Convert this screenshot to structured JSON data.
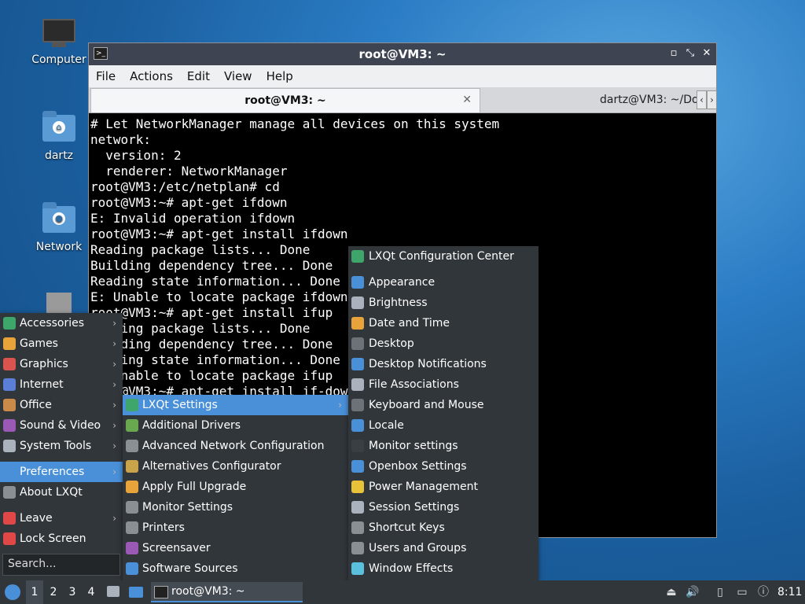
{
  "desktop": {
    "icons": [
      {
        "label": "Computer"
      },
      {
        "label": "dartz"
      },
      {
        "label": "Network"
      },
      {
        "label": ""
      }
    ]
  },
  "window": {
    "title": "root@VM3: ~",
    "controls": {
      "minimize": "▫",
      "maximize": "⤡",
      "close": "✕"
    },
    "menu": [
      "File",
      "Actions",
      "Edit",
      "View",
      "Help"
    ],
    "tabs": [
      {
        "label": "root@VM3: ~",
        "close": "✕"
      },
      {
        "label": "dartz@VM3: ~/Do"
      }
    ],
    "tab_scroll": {
      "left": "‹",
      "right": "›"
    }
  },
  "terminal": {
    "lines": [
      "# Let NetworkManager manage all devices on this system",
      "network:",
      "  version: 2",
      "  renderer: NetworkManager",
      "root@VM3:/etc/netplan# cd",
      "root@VM3:~# apt-get ifdown",
      "E: Invalid operation ifdown",
      "root@VM3:~# apt-get install ifdown",
      "Reading package lists... Done",
      "Building dependency tree... Done",
      "Reading state information... Done",
      "E: Unable to locate package ifdown",
      "root@VM3:~# apt-get install ifup",
      "Reading package lists... Done",
      "Building dependency tree... Done",
      "Reading state information... Done",
      "E: Unable to locate package ifup",
      "root@VM3:~# apt-get install if-down"
    ]
  },
  "menu_main": {
    "items": [
      {
        "label": "Accessories",
        "icon": "accessories-icon",
        "color": "#3fa66b",
        "submenu": true
      },
      {
        "label": "Games",
        "icon": "games-icon",
        "color": "#e8a33a",
        "submenu": true
      },
      {
        "label": "Graphics",
        "icon": "graphics-icon",
        "color": "#d9534f",
        "submenu": true
      },
      {
        "label": "Internet",
        "icon": "internet-icon",
        "color": "#5b7fd6",
        "submenu": true
      },
      {
        "label": "Office",
        "icon": "office-icon",
        "color": "#c98a4a",
        "submenu": true
      },
      {
        "label": "Sound & Video",
        "icon": "sound-video-icon",
        "color": "#9b59b6",
        "submenu": true
      },
      {
        "label": "System Tools",
        "icon": "system-tools-icon",
        "color": "#aab2bd",
        "submenu": true
      },
      {
        "label": "Preferences",
        "icon": "preferences-icon",
        "color": "#4a90d9",
        "submenu": true,
        "highlighted": true
      },
      {
        "label": "About LXQt",
        "icon": "info-icon",
        "color": "#8a8f94",
        "submenu": false
      },
      {
        "label": "Leave",
        "icon": "power-icon",
        "color": "#e04848",
        "submenu": true
      },
      {
        "label": "Lock Screen",
        "icon": "lock-icon",
        "color": "#e04848",
        "submenu": false
      }
    ],
    "search_placeholder": "Search..."
  },
  "menu_preferences": {
    "items": [
      {
        "label": "LXQt Settings",
        "icon": "lxqt-icon",
        "color": "#3fa66b",
        "submenu": true,
        "highlighted": true
      },
      {
        "label": "Additional Drivers",
        "icon": "drivers-icon",
        "color": "#6aa84f"
      },
      {
        "label": "Advanced Network Configuration",
        "icon": "network-config-icon",
        "color": "#8a8f94"
      },
      {
        "label": "Alternatives Configurator",
        "icon": "alternatives-icon",
        "color": "#c9a34a"
      },
      {
        "label": "Apply Full Upgrade",
        "icon": "upgrade-icon",
        "color": "#e8a33a"
      },
      {
        "label": "Monitor Settings",
        "icon": "monitor-icon",
        "color": "#8a8f94"
      },
      {
        "label": "Printers",
        "icon": "printer-icon",
        "color": "#8a8f94"
      },
      {
        "label": "Screensaver",
        "icon": "screensaver-icon",
        "color": "#9b59b6"
      },
      {
        "label": "Software Sources",
        "icon": "software-sources-icon",
        "color": "#4a90d9"
      }
    ]
  },
  "menu_lxqt": {
    "header": {
      "label": "LXQt Configuration Center",
      "icon": "config-center-icon",
      "color": "#3fa66b"
    },
    "items": [
      {
        "label": "Appearance",
        "icon": "appearance-icon",
        "color": "#4a90d9"
      },
      {
        "label": "Brightness",
        "icon": "brightness-icon",
        "color": "#aab2bd"
      },
      {
        "label": "Date and Time",
        "icon": "clock-icon",
        "color": "#e8a33a"
      },
      {
        "label": "Desktop",
        "icon": "desktop-icon",
        "color": "#6d7278"
      },
      {
        "label": "Desktop Notifications",
        "icon": "notification-icon",
        "color": "#4a90d9"
      },
      {
        "label": "File Associations",
        "icon": "file-assoc-icon",
        "color": "#aab2bd"
      },
      {
        "label": "Keyboard and Mouse",
        "icon": "mouse-icon",
        "color": "#6d7278"
      },
      {
        "label": "Locale",
        "icon": "locale-icon",
        "color": "#4a90d9"
      },
      {
        "label": "Monitor settings",
        "icon": "monitor-icon",
        "color": "#3a3f44"
      },
      {
        "label": "Openbox Settings",
        "icon": "openbox-icon",
        "color": "#4a90d9"
      },
      {
        "label": "Power Management",
        "icon": "power-management-icon",
        "color": "#e8c33a"
      },
      {
        "label": "Session Settings",
        "icon": "session-icon",
        "color": "#aab2bd"
      },
      {
        "label": "Shortcut Keys",
        "icon": "keyboard-icon",
        "color": "#8a8f94"
      },
      {
        "label": "Users and Groups",
        "icon": "users-icon",
        "color": "#8a8f94"
      },
      {
        "label": "Window Effects",
        "icon": "window-effects-icon",
        "color": "#5bc0de"
      }
    ]
  },
  "taskbar": {
    "workspaces": [
      "1",
      "2",
      "3",
      "4"
    ],
    "active_workspace": "1",
    "task_label": "root@VM3: ~",
    "clock": "8:11"
  }
}
